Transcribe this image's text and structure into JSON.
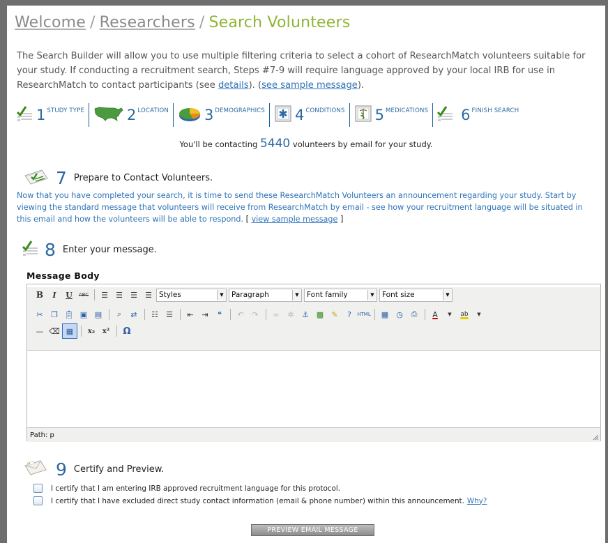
{
  "breadcrumb": {
    "items": [
      "Welcome",
      "Researchers"
    ],
    "separator": "/",
    "current": "Search Volunteers"
  },
  "intro": {
    "text_before": "The Search Builder will allow you to use multiple filtering criteria to select a cohort of ResearchMatch volunteers suitable for your study. If conducting a recruitment search, Steps #7-9 will require language approved by your local IRB for use in ResearchMatch to contact participants (see ",
    "details_link": "details",
    "text_middle": "). (",
    "sample_link": "see sample message",
    "text_after": ")."
  },
  "steps": [
    {
      "num": "1",
      "label": "STUDY TYPE",
      "icon": "checklist-icon"
    },
    {
      "num": "2",
      "label": "LOCATION",
      "icon": "us-map-icon"
    },
    {
      "num": "3",
      "label": "DEMOGRAPHICS",
      "icon": "pie-chart-icon"
    },
    {
      "num": "4",
      "label": "CONDITIONS",
      "icon": "medical-star-icon"
    },
    {
      "num": "5",
      "label": "MEDICATIONS",
      "icon": "caduceus-icon"
    },
    {
      "num": "6",
      "label": "FINISH SEARCH",
      "icon": "checklist-icon"
    }
  ],
  "count": {
    "prefix": "You'll be contacting",
    "number": "5440",
    "suffix": "volunteers by email for your study."
  },
  "step7": {
    "num": "7",
    "title": "Prepare to Contact Volunteers.",
    "text": "Now that you have completed your search, it is time to send these ResearchMatch Volunteers an announcement regarding your study.  Start by viewing the standard message that volunteers will receive from ResearchMatch by email - see how your recruitment language will be situated in this email and how the volunteers will be able to respond.",
    "bracket_open": "[",
    "link": "view sample message",
    "bracket_close": "]"
  },
  "step8": {
    "num": "8",
    "title": "Enter your message."
  },
  "editor": {
    "label": "Message Body",
    "styles_select": "Styles",
    "format_select": "Paragraph",
    "font_family_select": "Font family",
    "font_size_select": "Font size",
    "path": "Path: p",
    "content": ""
  },
  "step9": {
    "num": "9",
    "title": "Certify and Preview.",
    "certify_irb": "I certify that I am entering IRB approved recruitment language for this protocol.",
    "certify_contact": "I certify that I have excluded direct study contact information (email & phone number) within this announcement.",
    "why_link": "Why?",
    "preview_button": "PREVIEW EMAIL MESSAGE"
  },
  "colors": {
    "accent_green": "#8fb532",
    "step_blue": "#2c69a2",
    "link_blue": "#2d73b8"
  }
}
